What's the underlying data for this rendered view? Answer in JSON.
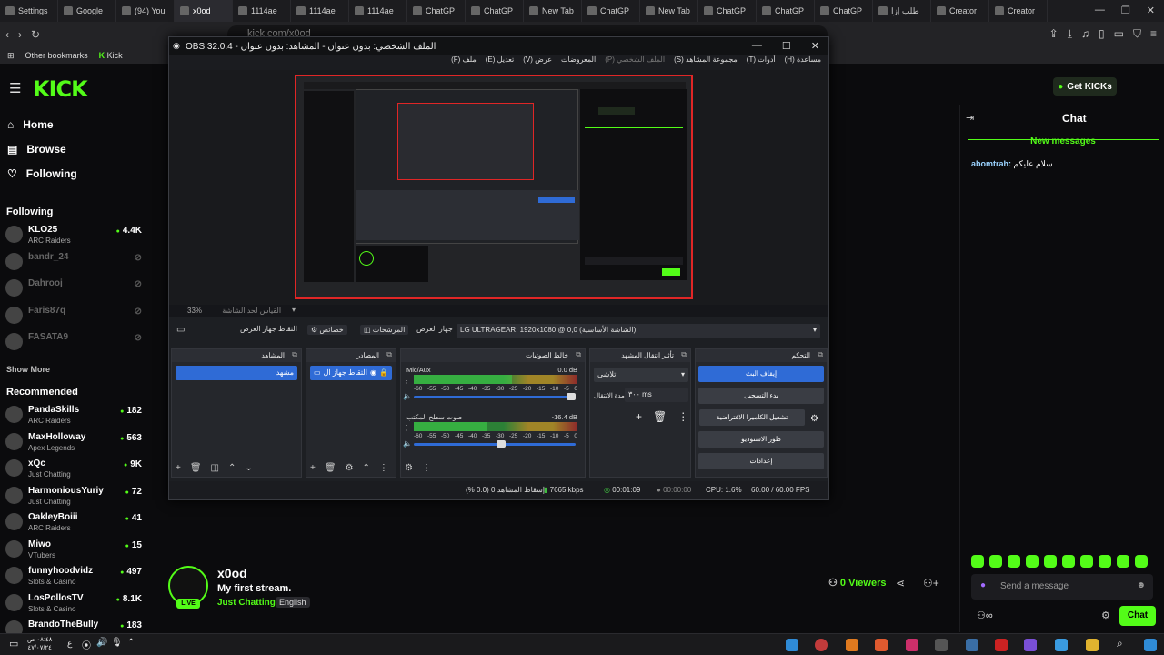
{
  "browser": {
    "tabs": [
      {
        "label": "Settings"
      },
      {
        "label": "Google"
      },
      {
        "label": "(94) You"
      },
      {
        "label": "x0od",
        "active": true
      },
      {
        "label": "1114ae"
      },
      {
        "label": "1114ae"
      },
      {
        "label": "1114ae"
      },
      {
        "label": "ChatGP"
      },
      {
        "label": "ChatGP"
      },
      {
        "label": "New Tab"
      },
      {
        "label": "ChatGP"
      },
      {
        "label": "New Tab"
      },
      {
        "label": "ChatGP"
      },
      {
        "label": "ChatGP"
      },
      {
        "label": "ChatGP"
      },
      {
        "label": "طلب إزا"
      },
      {
        "label": "Creator"
      },
      {
        "label": "Creator"
      }
    ],
    "url": "kick.com/x0od",
    "bookmarks": [
      "Other bookmarks",
      "Kick"
    ],
    "window_buttons": [
      "—",
      "❐",
      "✕"
    ]
  },
  "kick": {
    "logo": "KICK",
    "get_kicks": "Get KICKs",
    "nav": [
      {
        "label": "Home",
        "icon": "home-icon"
      },
      {
        "label": "Browse",
        "icon": "browse-icon"
      },
      {
        "label": "Following",
        "icon": "heart-icon"
      }
    ],
    "following_heading": "Following",
    "following": [
      {
        "name": "KLO25",
        "category": "ARC Raiders",
        "viewers": "4.4K",
        "online": true
      },
      {
        "name": "bandr_24",
        "category": "",
        "viewers": "",
        "online": false
      },
      {
        "name": "Dahrooj",
        "category": "",
        "viewers": "",
        "online": false
      },
      {
        "name": "Faris87q",
        "category": "",
        "viewers": "",
        "online": false
      },
      {
        "name": "FASATA9",
        "category": "",
        "viewers": "",
        "online": false
      }
    ],
    "show_more": "Show More",
    "recommended_heading": "Recommended",
    "recommended": [
      {
        "name": "PandaSkills",
        "category": "ARC Raiders",
        "viewers": "182"
      },
      {
        "name": "MaxHolloway",
        "category": "Apex Legends",
        "viewers": "563"
      },
      {
        "name": "xQc",
        "category": "Just Chatting",
        "viewers": "9K"
      },
      {
        "name": "HarmoniousYuriy",
        "category": "Just Chatting",
        "viewers": "72"
      },
      {
        "name": "OakleyBoiii",
        "category": "ARC Raiders",
        "viewers": "41"
      },
      {
        "name": "Miwo",
        "category": "VTubers",
        "viewers": "15"
      },
      {
        "name": "funnyhoodvidz",
        "category": "Slots & Casino",
        "viewers": "497"
      },
      {
        "name": "LosPollosTV",
        "category": "Slots & Casino",
        "viewers": "8.1K"
      },
      {
        "name": "BrandoTheBully",
        "category": "",
        "viewers": "183"
      }
    ],
    "stream": {
      "channel": "x0od",
      "title": "My first stream.",
      "category": "Just Chatting",
      "language": "English",
      "live_badge": "LIVE",
      "viewers": "0 Viewers"
    },
    "chat": {
      "title": "Chat",
      "new_messages": "New messages",
      "messages": [
        {
          "user": "abomtrah",
          "text": "سلام عليكم"
        }
      ],
      "placeholder": "Send a message",
      "send_button": "Chat"
    }
  },
  "obs": {
    "title": "OBS 32.0.4 - الملف الشخصي: بدون عنوان - المشاهد: بدون عنوان",
    "menu": [
      "ملف (F)",
      "تعديل (E)",
      "عرض (V)",
      "المعروضات",
      "الملف الشخصي (P)",
      "مجموعة المشاهد (S)",
      "أدوات (T)",
      "مساعدة (H)"
    ],
    "zoom": "33%",
    "zoom_hint": "القياس لحد الشاشة",
    "source_bar": {
      "source_name": "التقاط جهاز العرض",
      "properties": "خصائص",
      "filters": "المرشحات",
      "display_label": "جهاز العرض",
      "display_value": "LG ULTRAGEAR: 1920x1080 @ 0,0 (الشاشة الأساسية)"
    },
    "docks": {
      "scenes": {
        "title": "المشاهد",
        "items": [
          "مشهد"
        ]
      },
      "sources": {
        "title": "المصادر",
        "items": [
          "التقاط جهاز ال"
        ]
      },
      "mixer": {
        "title": "خالط الصوتيات",
        "channels": [
          {
            "name": "Mic/Aux",
            "db": "0.0 dB",
            "level": 0.6,
            "volume": 0.97
          },
          {
            "name": "صوت سطح المكتب",
            "db": "-16.4 dB",
            "level": 0.45,
            "volume": 0.54
          }
        ],
        "ticks": [
          "-60",
          "-55",
          "-50",
          "-45",
          "-40",
          "-35",
          "-30",
          "-25",
          "-20",
          "-15",
          "-10",
          "-5",
          "0"
        ]
      },
      "transitions": {
        "title": "تأثير انتقال المشهد",
        "selected": "تلاشي",
        "duration_label": "مدة الانتقال",
        "duration": "٣٠٠ ms"
      },
      "controls": {
        "title": "التحكم",
        "buttons": [
          "إيقاف البث",
          "بدء التسجيل",
          "تشغيل الكاميرا الافتراضية",
          "طور الاستوديو",
          "إعدادات"
        ]
      }
    },
    "status": {
      "dropped": "إسقاط المشاهد 0 (0.0 %)",
      "bitrate": "7665 kbps",
      "stream_time": "00:01:09",
      "rec_time": "00:00:00",
      "cpu": "CPU: 1.6%",
      "fps": "60.00 / 60.00 FPS"
    }
  },
  "taskbar": {
    "clock_time": "٠٨:٤٨ ص",
    "clock_date": "٤٧/٠٧/٢٤",
    "lang": "ع"
  }
}
